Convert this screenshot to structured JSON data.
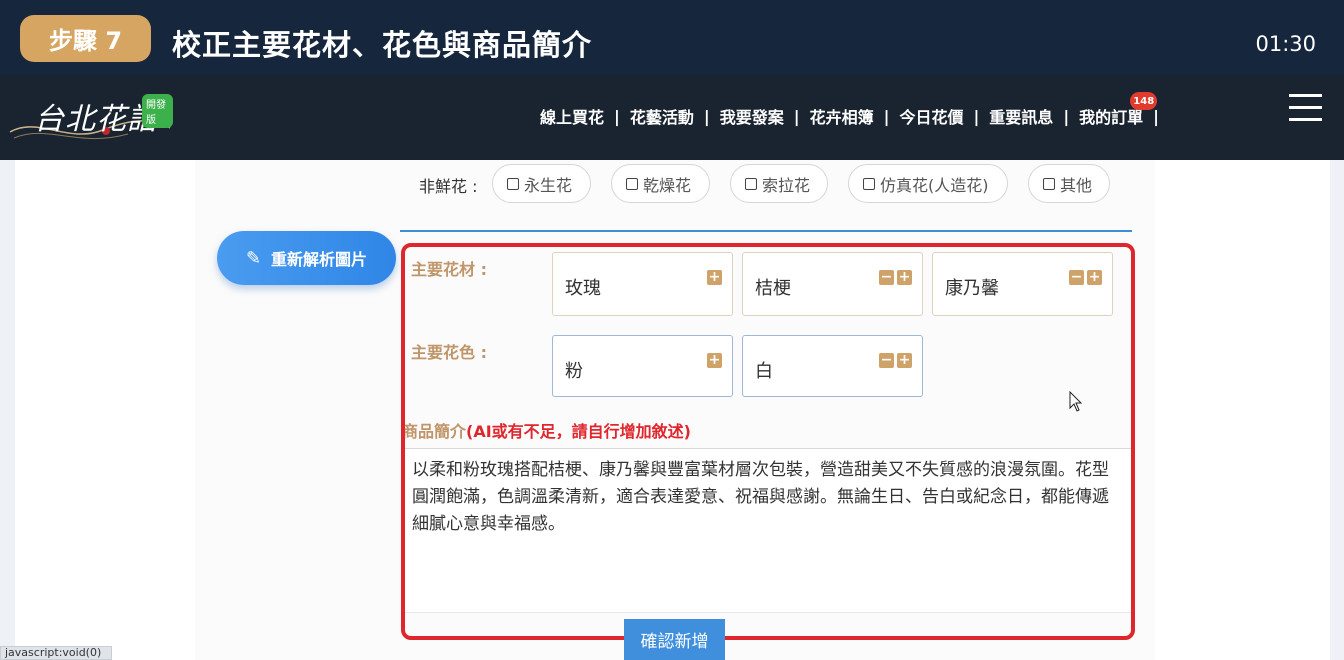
{
  "step": {
    "badge": "步驟 7",
    "title": "校正主要花材、花色與商品簡介",
    "timer": "01:30"
  },
  "header": {
    "logo_text": "台北花語",
    "logo_badge": "開發版",
    "nav": [
      {
        "label": "線上買花"
      },
      {
        "label": "花藝活動"
      },
      {
        "label": "我要發案"
      },
      {
        "label": "花卉相簿"
      },
      {
        "label": "今日花價"
      },
      {
        "label": "重要訊息"
      },
      {
        "label": "我的訂單",
        "badge": "148"
      }
    ],
    "menu_icon": "hamburger-icon"
  },
  "form": {
    "nonfresh_label": "非鮮花 :",
    "nonfresh_options": [
      "永生花",
      "乾燥花",
      "索拉花",
      "仿真花(人造花)",
      "其他"
    ],
    "reparse_button": "重新解析圖片",
    "main_material_label": "主要花材 :",
    "main_materials": [
      "玫瑰",
      "桔梗",
      "康乃馨"
    ],
    "main_color_label": "主要花色 :",
    "main_colors": [
      "粉",
      "白"
    ],
    "intro_label": "商品簡介",
    "intro_hint": "(AI或有不足，請自行增加敘述)",
    "intro_text": "以柔和粉玫瑰搭配桔梗、康乃馨與豐富葉材層次包裝，營造甜美又不失質感的浪漫氛圍。花型圓潤飽滿，色調溫柔清新，適合表達愛意、祝福與感謝。無論生日、告白或紀念日，都能傳遞細膩心意與幸福感。",
    "confirm_button": "確認新增"
  },
  "status_bar": {
    "url": "javascript:void(0)"
  },
  "colors": {
    "banner_bg": "#15263d",
    "badge_gold": "#d6a561",
    "highlight_red": "#e0262d",
    "primary_blue": "#3f8fdc"
  }
}
